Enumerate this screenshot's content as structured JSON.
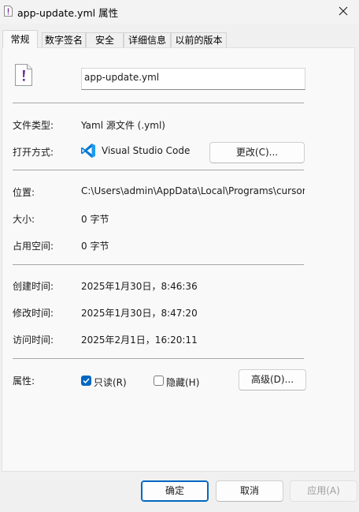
{
  "window": {
    "title": "app-update.yml 属性"
  },
  "tabs": [
    "常规",
    "数字签名",
    "安全",
    "详细信息",
    "以前的版本"
  ],
  "general": {
    "filename": "app-update.yml",
    "file_type_label": "文件类型:",
    "file_type_value": "Yaml 源文件 (.yml)",
    "open_with_label": "打开方式:",
    "open_with_value": "Visual Studio Code",
    "change_button": "更改(C)...",
    "location_label": "位置:",
    "location_value": "C:\\Users\\admin\\AppData\\Local\\Programs\\cursor\\",
    "size_label": "大小:",
    "size_value": "0 字节",
    "disk_size_label": "占用空间:",
    "disk_size_value": "0 字节",
    "created_label": "创建时间:",
    "created_value": "2025年1月30日，8:46:36",
    "modified_label": "修改时间:",
    "modified_value": "2025年1月30日，8:47:20",
    "accessed_label": "访问时间:",
    "accessed_value": "2025年2月1日，16:20:11",
    "attributes_label": "属性:",
    "readonly_label": "只读(R)",
    "readonly_checked": true,
    "hidden_label": "隐藏(H)",
    "hidden_checked": false,
    "advanced_button": "高级(D)..."
  },
  "footer": {
    "ok": "确定",
    "cancel": "取消",
    "apply": "应用(A)"
  },
  "colors": {
    "accent": "#0067c0",
    "vscode_blue": "#0078d4"
  }
}
